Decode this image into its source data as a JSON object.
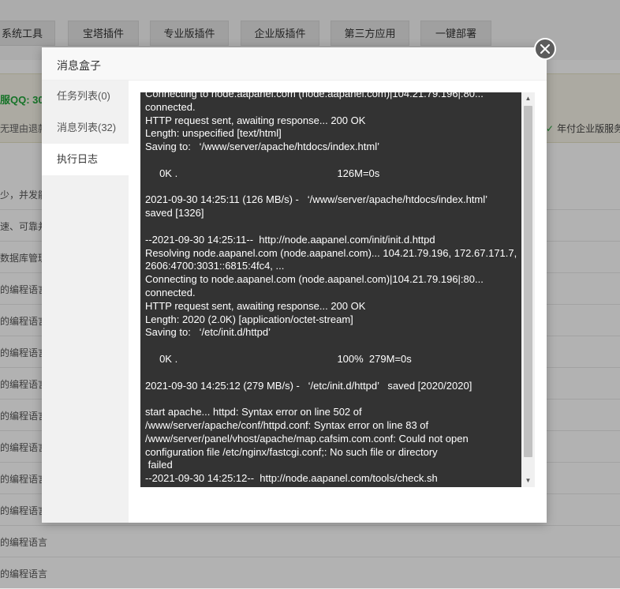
{
  "background": {
    "tabs": [
      "系统工具",
      "宝塔插件",
      "专业版插件",
      "企业版插件",
      "第三方应用",
      "一键部署"
    ],
    "notice_qq": "服QQ: 30",
    "notice_refund": "无理由退款",
    "notice_right": "年付企业版服务",
    "rows": [
      "少，并发能",
      "速、可靠并",
      "数据库管理",
      "的编程语言",
      "的编程语言",
      "的编程语言",
      "的编程语言",
      "的编程语言",
      "的编程语言",
      "的编程语言",
      "的编程语言",
      "的编程语言",
      "的编程语言"
    ]
  },
  "modal": {
    "title": "消息盒子",
    "sidebar": [
      {
        "label": "任务列表(0)"
      },
      {
        "label": "消息列表(32)"
      },
      {
        "label": "执行日志"
      }
    ],
    "log": "Connecting to node.aapanel.com (node.aapanel.com)|104.21.79.196|:80...\nconnected.\nHTTP request sent, awaiting response... 200 OK\nLength: unspecified [text/html]\nSaving to:   ‘/www/server/apache/htdocs/index.html’\n\n     0K .                                                        126M=0s\n\n2021-09-30 14:25:11 (126 MB/s) -   ‘/www/server/apache/htdocs/index.html’\nsaved [1326]\n\n--2021-09-30 14:25:11--  http://node.aapanel.com/init/init.d.httpd\nResolving node.aapanel.com (node.aapanel.com)... 104.21.79.196, 172.67.171.7,\n2606:4700:3031::6815:4fc4, ...\nConnecting to node.aapanel.com (node.aapanel.com)|104.21.79.196|:80...\nconnected.\nHTTP request sent, awaiting response... 200 OK\nLength: 2020 (2.0K) [application/octet-stream]\nSaving to:   ‘/etc/init.d/httpd’\n\n     0K .                                                        100%  279M=0s\n\n2021-09-30 14:25:12 (279 MB/s) -   ‘/etc/init.d/httpd’   saved [2020/2020]\n\nstart apache... httpd: Syntax error on line 502 of\n/www/server/apache/conf/httpd.conf: Syntax error on line 83 of\n/www/server/panel/vhost/apache/map.cafsim.com.conf: Could not open\nconfiguration file /etc/nginx/fastcgi.conf;: No such file or directory\n failed\n--2021-09-30 14:25:12--  http://node.aapanel.com/tools/check.sh"
  }
}
